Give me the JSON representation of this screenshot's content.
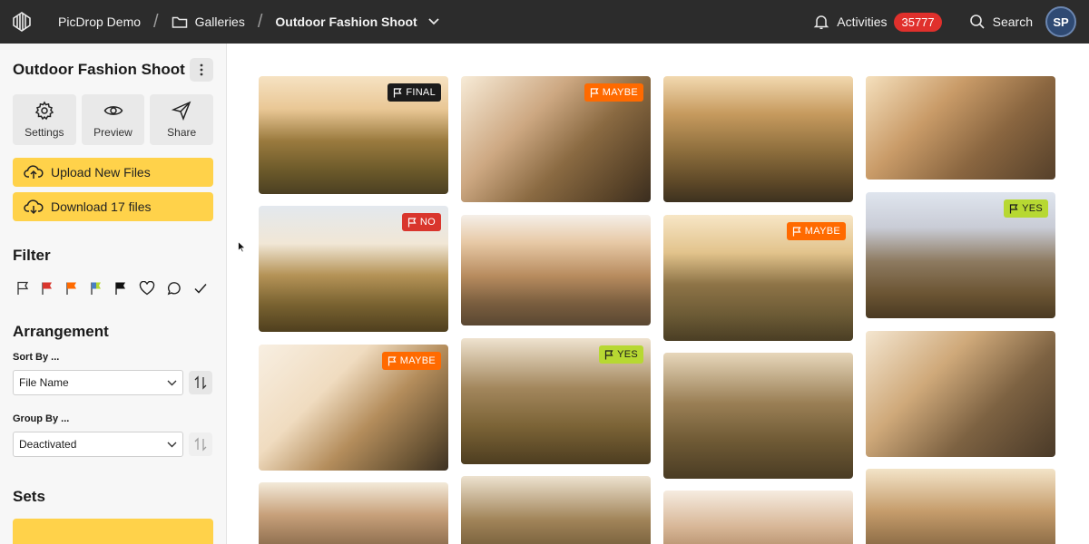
{
  "topbar": {
    "brand": "PicDrop Demo",
    "breadcrumb_galleries": "Galleries",
    "breadcrumb_current": "Outdoor Fashion Shoot",
    "activities_label": "Activities",
    "activities_count": "35777",
    "search_label": "Search",
    "avatar_initials": "SP"
  },
  "sidebar": {
    "gallery_title": "Outdoor Fashion Shoot",
    "tiles": [
      {
        "label": "Settings",
        "icon": "gear-icon"
      },
      {
        "label": "Preview",
        "icon": "eye-icon"
      },
      {
        "label": "Share",
        "icon": "send-icon"
      }
    ],
    "upload_label": "Upload New Files",
    "download_label": "Download 17 files",
    "filter_title": "Filter",
    "arrangement_title": "Arrangement",
    "sort_by_label": "Sort By ...",
    "sort_by_value": "File Name",
    "group_by_label": "Group By ...",
    "group_by_value": "Deactivated",
    "sets_title": "Sets"
  },
  "colors": {
    "accent_yellow": "#ffd24a",
    "topbar": "#2c2c2c",
    "badge_red": "#e0302c",
    "tag_final": "#1b1b1b",
    "tag_maybe": "#ff6a00",
    "tag_no": "#d9362d",
    "tag_yes": "#b7d832"
  },
  "photos": {
    "tags": {
      "final": "FINAL",
      "maybe": "MAYBE",
      "no": "NO",
      "yes": "YES"
    }
  }
}
